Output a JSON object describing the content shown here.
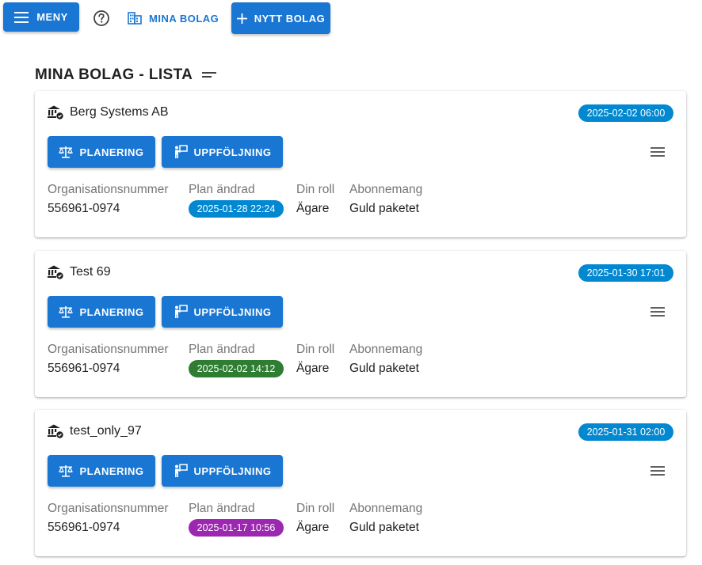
{
  "toolbar": {
    "menu_label": "MENY",
    "help_icon": "help-circle-icon",
    "my_companies_label": "MINA BOLAG",
    "new_company_label": "NYTT BOLAG"
  },
  "page": {
    "title": "MINA BOLAG - LISTA",
    "sort_icon": "sort-lines-icon"
  },
  "labels": {
    "org_number": "Organisationsnummer",
    "plan_changed": "Plan ändrad",
    "role": "Din roll",
    "subscription": "Abonnemang",
    "planning_button": "PLANERING",
    "followup_button": "UPPFÖLJNING"
  },
  "colors": {
    "primary": "#1976d2",
    "date_chip": "#0288d1",
    "chip_green": "#2e7d32",
    "chip_purple": "#9c27b0"
  },
  "companies": [
    {
      "name": "Berg Systems AB",
      "date": "2025-02-02 06:00",
      "org_number": "556961-0974",
      "plan_changed": "2025-01-28 22:24",
      "plan_chip_color": "#0288d1",
      "role": "Ägare",
      "subscription": "Guld paketet"
    },
    {
      "name": "Test 69",
      "date": "2025-01-30 17:01",
      "org_number": "556961-0974",
      "plan_changed": "2025-02-02 14:12",
      "plan_chip_color": "#2e7d32",
      "role": "Ägare",
      "subscription": "Guld paketet"
    },
    {
      "name": "test_only_97",
      "date": "2025-01-31 02:00",
      "org_number": "556961-0974",
      "plan_changed": "2025-01-17 10:56",
      "plan_chip_color": "#9c27b0",
      "role": "Ägare",
      "subscription": "Guld paketet"
    }
  ]
}
